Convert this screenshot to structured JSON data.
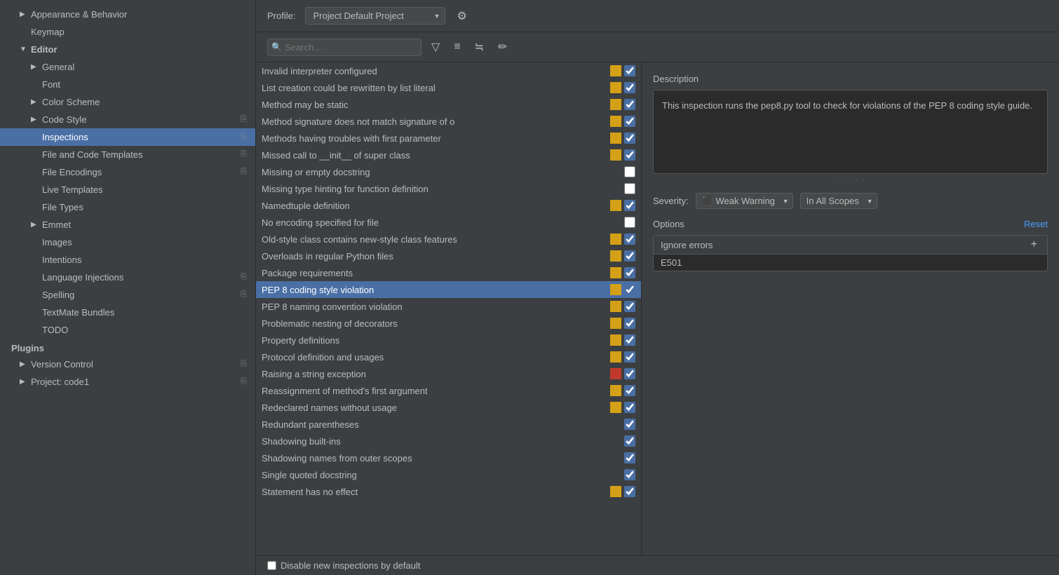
{
  "sidebar": {
    "sections": [
      {
        "type": "item",
        "label": "Appearance & Behavior",
        "indent": 1,
        "arrow": "▶",
        "active": false
      },
      {
        "type": "item",
        "label": "Keymap",
        "indent": 1,
        "arrow": "",
        "active": false
      },
      {
        "type": "item",
        "label": "Editor",
        "indent": 1,
        "arrow": "▼",
        "active": false,
        "bold": true
      },
      {
        "type": "item",
        "label": "General",
        "indent": 2,
        "arrow": "▶",
        "active": false
      },
      {
        "type": "item",
        "label": "Font",
        "indent": 2,
        "arrow": "",
        "active": false
      },
      {
        "type": "item",
        "label": "Color Scheme",
        "indent": 2,
        "arrow": "▶",
        "active": false
      },
      {
        "type": "item",
        "label": "Code Style",
        "indent": 2,
        "arrow": "▶",
        "active": false,
        "icon": "⎘"
      },
      {
        "type": "item",
        "label": "Inspections",
        "indent": 2,
        "arrow": "",
        "active": true,
        "icon": "⎘"
      },
      {
        "type": "item",
        "label": "File and Code Templates",
        "indent": 2,
        "arrow": "",
        "active": false,
        "icon": "⎘"
      },
      {
        "type": "item",
        "label": "File Encodings",
        "indent": 2,
        "arrow": "",
        "active": false,
        "icon": "⎘"
      },
      {
        "type": "item",
        "label": "Live Templates",
        "indent": 2,
        "arrow": "",
        "active": false
      },
      {
        "type": "item",
        "label": "File Types",
        "indent": 2,
        "arrow": "",
        "active": false
      },
      {
        "type": "item",
        "label": "Emmet",
        "indent": 2,
        "arrow": "▶",
        "active": false
      },
      {
        "type": "item",
        "label": "Images",
        "indent": 2,
        "arrow": "",
        "active": false
      },
      {
        "type": "item",
        "label": "Intentions",
        "indent": 2,
        "arrow": "",
        "active": false
      },
      {
        "type": "item",
        "label": "Language Injections",
        "indent": 2,
        "arrow": "",
        "active": false,
        "icon": "⎘"
      },
      {
        "type": "item",
        "label": "Spelling",
        "indent": 2,
        "arrow": "",
        "active": false,
        "icon": "⎘"
      },
      {
        "type": "item",
        "label": "TextMate Bundles",
        "indent": 2,
        "arrow": "",
        "active": false
      },
      {
        "type": "item",
        "label": "TODO",
        "indent": 2,
        "arrow": "",
        "active": false
      },
      {
        "type": "header",
        "label": "Plugins",
        "indent": 1
      },
      {
        "type": "item",
        "label": "Version Control",
        "indent": 1,
        "arrow": "▶",
        "active": false,
        "icon": "⎘"
      },
      {
        "type": "item",
        "label": "Project: code1",
        "indent": 1,
        "arrow": "▶",
        "active": false,
        "icon": "⎘"
      }
    ]
  },
  "profile": {
    "label": "Profile:",
    "value": "Project Default",
    "sub_value": "Project",
    "gear_icon": "⚙"
  },
  "toolbar": {
    "search_placeholder": "Search...",
    "filter_icon": "⊧",
    "expand_icon": "≡",
    "collapse_icon": "≒",
    "clear_icon": "✏"
  },
  "inspections": [
    {
      "name": "Invalid interpreter configured",
      "severity": "yellow",
      "checked": true
    },
    {
      "name": "List creation could be rewritten by list literal",
      "severity": "yellow",
      "checked": true
    },
    {
      "name": "Method may be static",
      "severity": "yellow",
      "checked": true
    },
    {
      "name": "Method signature does not match signature of o",
      "severity": "yellow",
      "checked": true
    },
    {
      "name": "Methods having troubles with first parameter",
      "severity": "yellow",
      "checked": true
    },
    {
      "name": "Missed call to __init__ of super class",
      "severity": "yellow",
      "checked": true
    },
    {
      "name": "Missing or empty docstring",
      "severity": "none",
      "checked": false
    },
    {
      "name": "Missing type hinting for function definition",
      "severity": "none",
      "checked": false
    },
    {
      "name": "Namedtuple definition",
      "severity": "yellow",
      "checked": true
    },
    {
      "name": "No encoding specified for file",
      "severity": "none",
      "checked": false
    },
    {
      "name": "Old-style class contains new-style class features",
      "severity": "yellow",
      "checked": true
    },
    {
      "name": "Overloads in regular Python files",
      "severity": "yellow",
      "checked": true
    },
    {
      "name": "Package requirements",
      "severity": "yellow",
      "checked": true
    },
    {
      "name": "PEP 8 coding style violation",
      "severity": "yellow",
      "checked": true,
      "selected": true
    },
    {
      "name": "PEP 8 naming convention violation",
      "severity": "yellow",
      "checked": true
    },
    {
      "name": "Problematic nesting of decorators",
      "severity": "yellow",
      "checked": true
    },
    {
      "name": "Property definitions",
      "severity": "yellow",
      "checked": true
    },
    {
      "name": "Protocol definition and usages",
      "severity": "yellow",
      "checked": true
    },
    {
      "name": "Raising a string exception",
      "severity": "red",
      "checked": true
    },
    {
      "name": "Reassignment of method's first argument",
      "severity": "yellow",
      "checked": true
    },
    {
      "name": "Redeclared names without usage",
      "severity": "yellow",
      "checked": true
    },
    {
      "name": "Redundant parentheses",
      "severity": "gray",
      "checked": true
    },
    {
      "name": "Shadowing built-ins",
      "severity": "gray",
      "checked": true
    },
    {
      "name": "Shadowing names from outer scopes",
      "severity": "gray",
      "checked": true
    },
    {
      "name": "Single quoted docstring",
      "severity": "gray",
      "checked": true
    },
    {
      "name": "Statement has no effect",
      "severity": "yellow",
      "checked": true
    }
  ],
  "description": {
    "label": "Description",
    "text": "This inspection runs the pep8.py tool to check for violations of the PEP 8 coding style guide."
  },
  "severity_row": {
    "label": "Severity:",
    "severity_value": "Weak Warning",
    "scope_value": "In All Scopes",
    "severity_color": "#c8a020"
  },
  "options": {
    "label": "Options",
    "reset_label": "Reset",
    "table_header": "Ignore errors",
    "add_icon": "+",
    "rows": [
      "E501"
    ]
  },
  "bottom_bar": {
    "checkbox_label": "Disable new inspections by default",
    "checked": false
  }
}
